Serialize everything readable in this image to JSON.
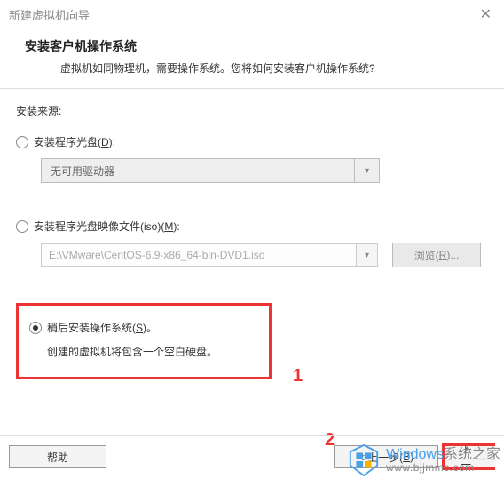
{
  "window": {
    "title": "新建虚拟机向导"
  },
  "header": {
    "title": "安装客户机操作系统",
    "subtitle": "虚拟机如同物理机，需要操作系统。您将如何安装客户机操作系统?"
  },
  "source_label": "安装来源:",
  "option_disc": {
    "label_pre": "安装程序光盘(",
    "hotkey": "D",
    "label_post": "):"
  },
  "drive_combo": {
    "value": "无可用驱动器"
  },
  "option_iso": {
    "label_pre": "安装程序光盘映像文件(iso)(",
    "hotkey": "M",
    "label_post": "):"
  },
  "iso_path": {
    "value": "E:\\VMware\\CentOS-6.9-x86_64-bin-DVD1.iso"
  },
  "browse": {
    "label_pre": "浏览(",
    "hotkey": "R",
    "label_post": ")..."
  },
  "option_later": {
    "label_pre": "稍后安装操作系统(",
    "hotkey": "S",
    "label_post": ")。"
  },
  "later_helper": "创建的虚拟机将包含一个空白硬盘。",
  "annotations": {
    "one": "1",
    "two": "2"
  },
  "buttons": {
    "help": "帮助",
    "back_pre": "< 上一步(",
    "back_hotkey": "B",
    "back_post": ")",
    "next": "下一"
  },
  "watermark": {
    "brand_colored": "Windows",
    "brand_gray": "系统之家",
    "url": "www.bjjmmc.com"
  }
}
